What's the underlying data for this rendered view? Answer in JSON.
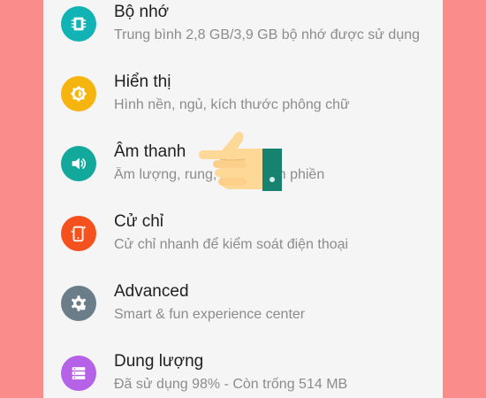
{
  "settings": {
    "items": [
      {
        "title": "Bộ nhớ",
        "subtitle": "Trung bình 2,8 GB/3,9 GB bộ nhớ được sử dụng",
        "icon": "memory-chip-icon",
        "color": "#12b3b4"
      },
      {
        "title": "Hiển thị",
        "subtitle": "Hình nền, ngủ, kích thước phông chữ",
        "icon": "brightness-icon",
        "color": "#f6b40f"
      },
      {
        "title": "Âm thanh",
        "subtitle": "Âm lượng, rung, không làm phiền",
        "icon": "volume-icon",
        "color": "#12a89c"
      },
      {
        "title": "Cử chỉ",
        "subtitle": "Cử chỉ nhanh để kiểm soát điện thoại",
        "icon": "gesture-phone-icon",
        "color": "#f4511e"
      },
      {
        "title": "Advanced",
        "subtitle": "Smart & fun experience center",
        "icon": "gear-icon",
        "color": "#6b7d88"
      },
      {
        "title": "Dung lượng",
        "subtitle": "Đã sử dụng 98% - Còn trống 514 MB",
        "icon": "storage-icon",
        "color": "#b561e8"
      }
    ]
  },
  "overlay": {
    "icon": "pointing-hand-icon"
  }
}
